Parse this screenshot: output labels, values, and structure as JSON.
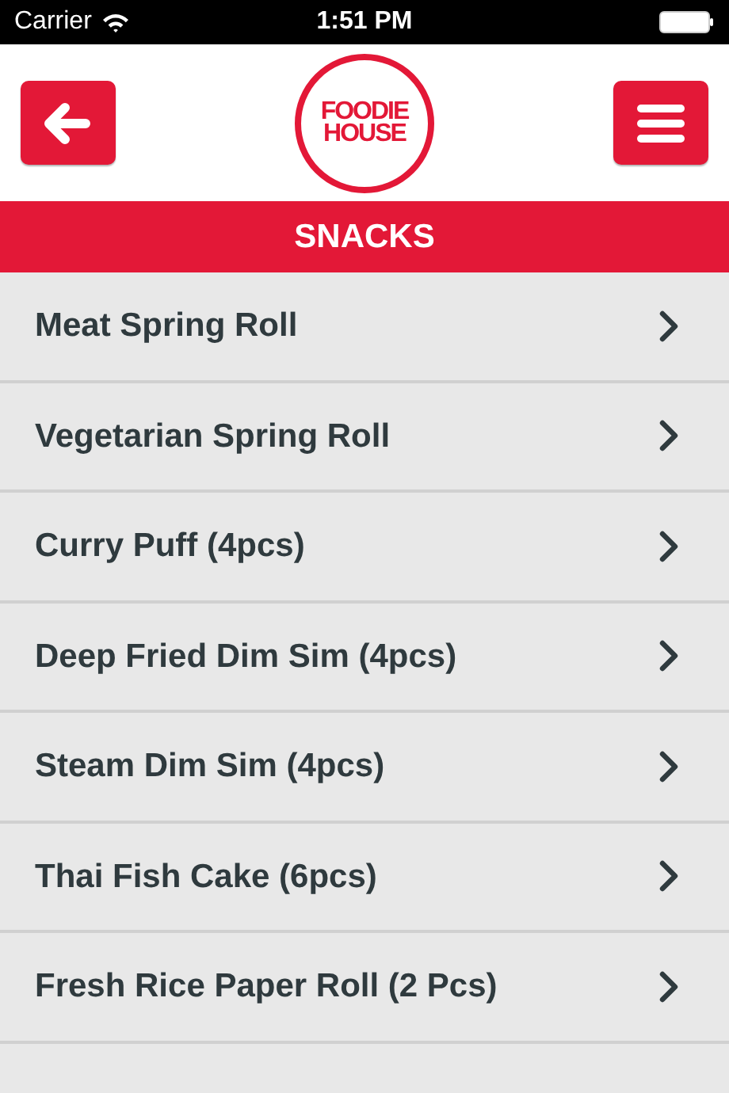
{
  "status_bar": {
    "carrier": "Carrier",
    "time": "1:51 PM"
  },
  "header": {
    "logo_lines": [
      "FOODIE",
      "HOUSE"
    ]
  },
  "section_title": "SNACKS",
  "items": [
    {
      "name": "Meat Spring Roll"
    },
    {
      "name": "Vegetarian Spring Roll"
    },
    {
      "name": "Curry Puff (4pcs)"
    },
    {
      "name": "Deep Fried Dim Sim (4pcs)"
    },
    {
      "name": "Steam Dim Sim (4pcs)"
    },
    {
      "name": "Thai Fish Cake (6pcs)"
    },
    {
      "name": "Fresh Rice Paper Roll (2 Pcs)"
    }
  ]
}
